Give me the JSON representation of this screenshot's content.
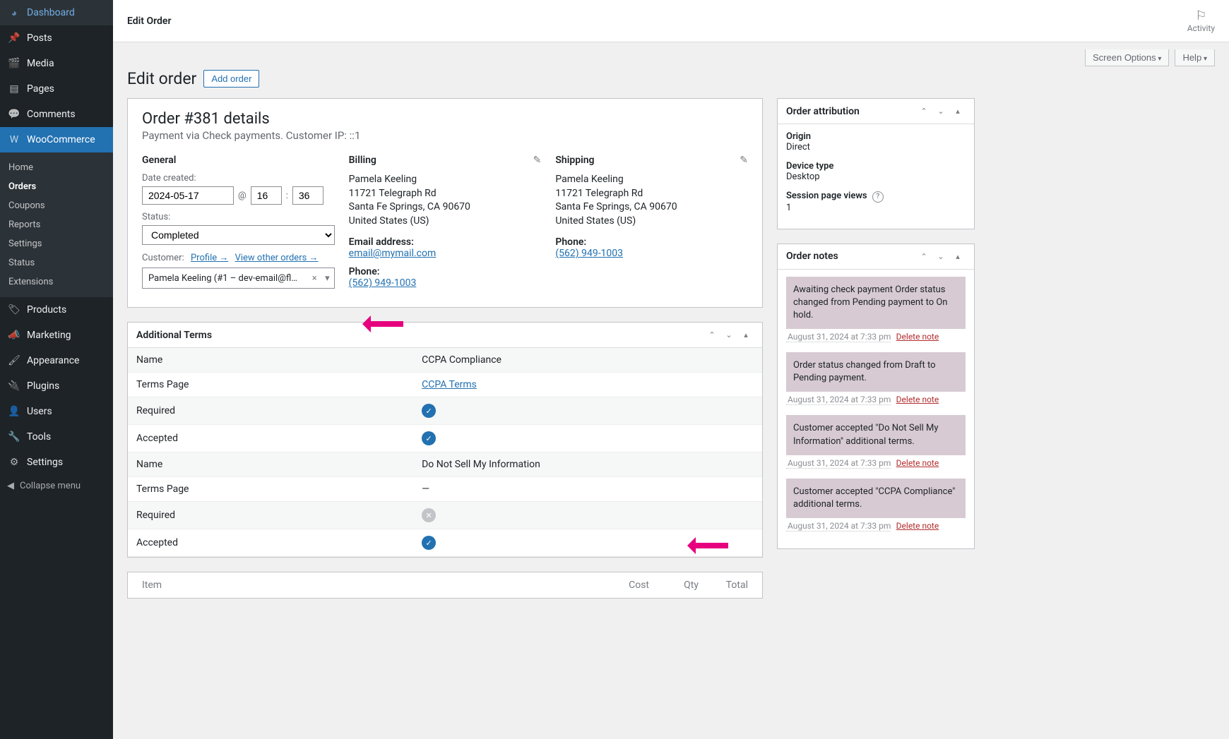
{
  "sidebar": {
    "items": [
      {
        "label": "Dashboard",
        "icon": "dashboard"
      },
      {
        "label": "Posts",
        "icon": "pin"
      },
      {
        "label": "Media",
        "icon": "media"
      },
      {
        "label": "Pages",
        "icon": "page"
      },
      {
        "label": "Comments",
        "icon": "comment"
      },
      {
        "label": "WooCommerce",
        "icon": "woo",
        "current": true
      },
      {
        "label": "Products",
        "icon": "tag"
      },
      {
        "label": "Marketing",
        "icon": "megaphone"
      },
      {
        "label": "Appearance",
        "icon": "brush"
      },
      {
        "label": "Plugins",
        "icon": "plug"
      },
      {
        "label": "Users",
        "icon": "user"
      },
      {
        "label": "Tools",
        "icon": "wrench"
      },
      {
        "label": "Settings",
        "icon": "gear"
      }
    ],
    "submenu": [
      "Home",
      "Orders",
      "Coupons",
      "Reports",
      "Settings",
      "Status",
      "Extensions"
    ],
    "submenu_active": "Orders",
    "collapse": "Collapse menu"
  },
  "topbar": {
    "title": "Edit Order",
    "activity": "Activity"
  },
  "tabs": {
    "screen_options": "Screen Options",
    "help": "Help"
  },
  "page": {
    "heading": "Edit order",
    "add_btn": "Add order"
  },
  "order": {
    "title": "Order #381 details",
    "subtitle": "Payment via Check payments. Customer IP: ::1",
    "general": {
      "heading": "General",
      "date_label": "Date created:",
      "date": "2024-05-17",
      "hour": "16",
      "minute": "36",
      "status_label": "Status:",
      "status": "Completed",
      "customer_label": "Customer:",
      "profile_link": "Profile →",
      "other_orders_link": "View other orders →",
      "customer_value": "Pamela Keeling (#1 – dev-email@fl…"
    },
    "billing": {
      "heading": "Billing",
      "name": "Pamela Keeling",
      "line1": "11721 Telegraph Rd",
      "line2": "Santa Fe Springs, CA 90670",
      "country": "United States (US)",
      "email_label": "Email address:",
      "email": "email@mymail.com",
      "phone_label": "Phone:",
      "phone": "(562) 949-1003"
    },
    "shipping": {
      "heading": "Shipping",
      "name": "Pamela Keeling",
      "line1": "11721 Telegraph Rd",
      "line2": "Santa Fe Springs, CA 90670",
      "country": "United States (US)",
      "phone_label": "Phone:",
      "phone": "(562) 949-1003"
    }
  },
  "terms": {
    "heading": "Additional Terms",
    "rows": [
      {
        "label": "Name",
        "value": "CCPA Compliance",
        "type": "text"
      },
      {
        "label": "Terms Page",
        "value": "CCPA Terms",
        "type": "link"
      },
      {
        "label": "Required",
        "type": "check"
      },
      {
        "label": "Accepted",
        "type": "check"
      },
      {
        "label": "Name",
        "value": "Do Not Sell My Information",
        "type": "text"
      },
      {
        "label": "Terms Page",
        "value": "—",
        "type": "text"
      },
      {
        "label": "Required",
        "type": "x"
      },
      {
        "label": "Accepted",
        "type": "check"
      }
    ]
  },
  "items": {
    "item": "Item",
    "cost": "Cost",
    "qty": "Qty",
    "total": "Total"
  },
  "attribution": {
    "heading": "Order attribution",
    "origin_label": "Origin",
    "origin": "Direct",
    "device_label": "Device type",
    "device": "Desktop",
    "views_label": "Session page views",
    "views": "1"
  },
  "notes": {
    "heading": "Order notes",
    "delete_label": "Delete note",
    "list": [
      {
        "text": "Awaiting check payment Order status changed from Pending payment to On hold.",
        "time": "August 31, 2024 at 7:33 pm"
      },
      {
        "text": "Order status changed from Draft to Pending payment.",
        "time": "August 31, 2024 at 7:33 pm"
      },
      {
        "text": "Customer accepted \"Do Not Sell My Information\" additional terms.",
        "time": "August 31, 2024 at 7:33 pm"
      },
      {
        "text": "Customer accepted \"CCPA Compliance\" additional terms.",
        "time": "August 31, 2024 at 7:33 pm"
      }
    ]
  }
}
